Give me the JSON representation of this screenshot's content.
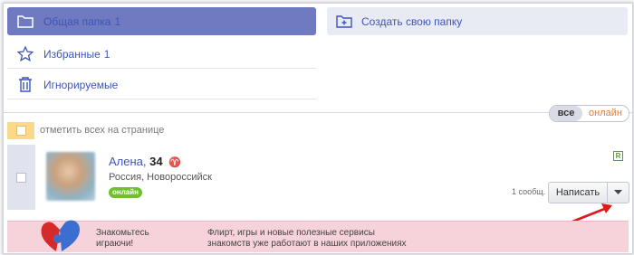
{
  "folders": {
    "common": {
      "label": "Общая папка",
      "count": "1"
    },
    "favorites": {
      "label": "Избранные",
      "count": "1"
    },
    "ignored": {
      "label": "Игнорируемые"
    }
  },
  "create_folder_label": "Создать свою папку",
  "filter": {
    "all_label": "все",
    "online_label": "онлайн",
    "selected": "все"
  },
  "select_all_label": "отметить всех на странице",
  "user": {
    "name": "Алена,",
    "age": "34",
    "zodiac_icon": "aries-icon",
    "location": "Россия, Новороссийск",
    "status": "онлайн",
    "badge": "R",
    "messages": "1 сообщ.",
    "write_label": "Написать"
  },
  "banner": {
    "line1a": "Знакомьтесь",
    "line1b": "играючи!",
    "line2a": "Флирт, игры и новые полезные сервисы",
    "line2b": "знакомств уже работают в наших приложениях"
  },
  "colors": {
    "accent": "#6f7ac0",
    "link": "#3d55b8",
    "online": "#70c02d",
    "orange": "#f07a22",
    "banner_bg": "#f6d2da"
  }
}
